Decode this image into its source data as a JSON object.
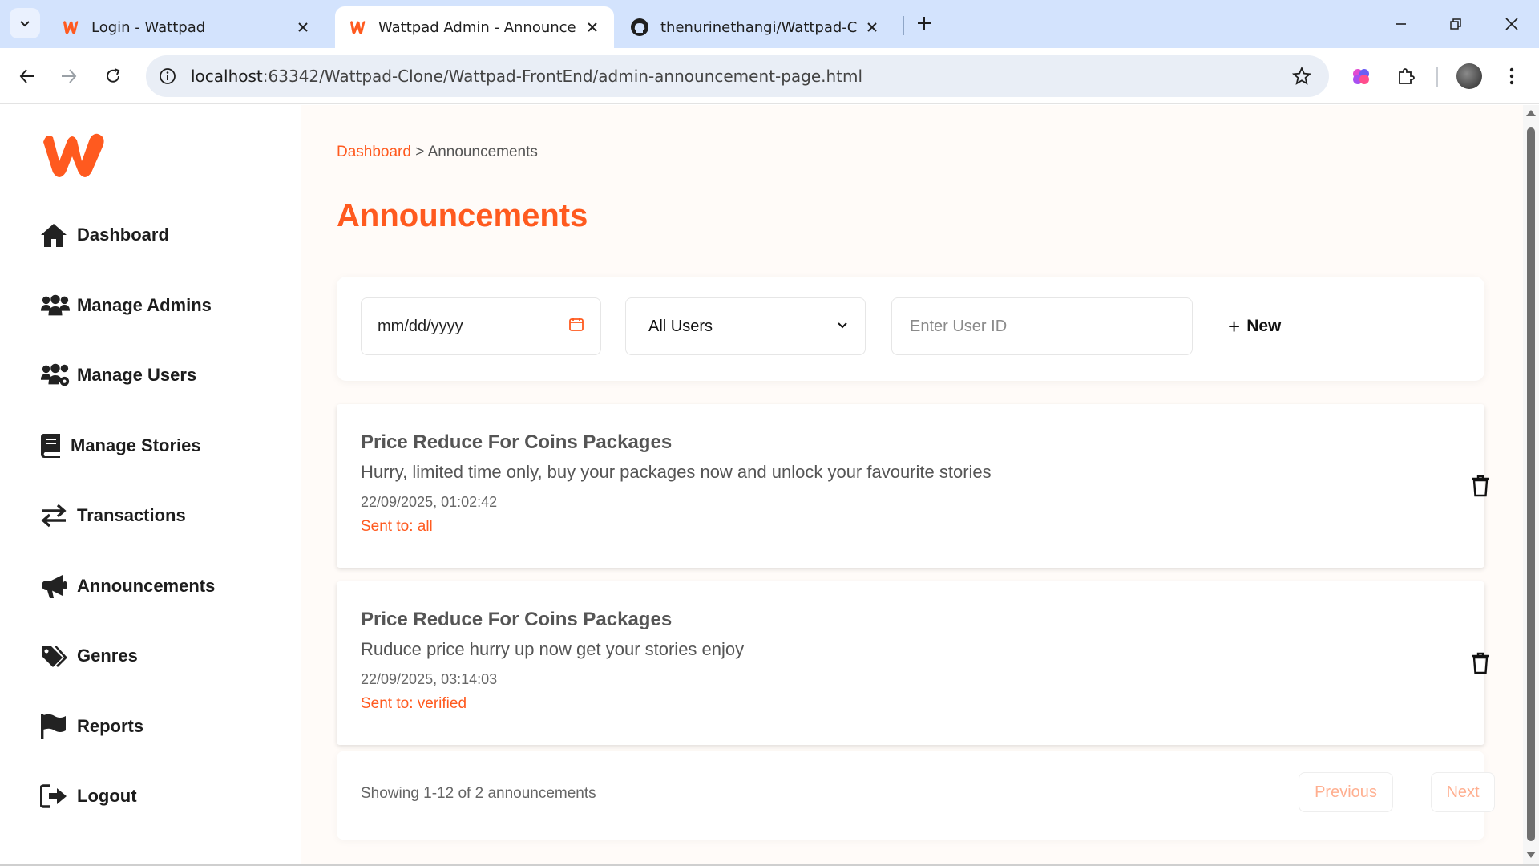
{
  "browser": {
    "tabs": [
      {
        "title": "Login - Wattpad",
        "active": false,
        "favicon": "wattpad-icon"
      },
      {
        "title": "Wattpad Admin - Announcements",
        "active": true,
        "favicon": "wattpad-icon"
      },
      {
        "title": "thenurinethangi/Wattpad-Clone",
        "active": false,
        "favicon": "github-icon"
      }
    ],
    "url_host": "localhost",
    "url_rest": ":63342/Wattpad-Clone/Wattpad-FrontEnd/admin-announcement-page.html"
  },
  "sidebar": {
    "items": [
      {
        "label": "Dashboard",
        "icon": "home-icon"
      },
      {
        "label": "Manage Admins",
        "icon": "users-icon"
      },
      {
        "label": "Manage Users",
        "icon": "users-gear-icon"
      },
      {
        "label": "Manage Stories",
        "icon": "book-icon"
      },
      {
        "label": "Transactions",
        "icon": "arrows-exchange-icon"
      },
      {
        "label": "Announcements",
        "icon": "megaphone-icon"
      },
      {
        "label": "Genres",
        "icon": "tags-icon"
      },
      {
        "label": "Reports",
        "icon": "flag-icon"
      },
      {
        "label": "Logout",
        "icon": "logout-icon"
      }
    ]
  },
  "breadcrumb": {
    "link": "Dashboard",
    "separator": " > ",
    "current": "Announcements"
  },
  "page_title": "Announcements",
  "filters": {
    "date_placeholder": "mm/dd/yyyy",
    "audience_selected": "All Users",
    "user_id_placeholder": "Enter User ID",
    "new_label": "New"
  },
  "announcements": [
    {
      "title": "Price Reduce For Coins Packages",
      "body": "Hurry, limited time only, buy your packages now and unlock your favourite stories",
      "timestamp": "22/09/2025, 01:02:42",
      "sent_to": "Sent to: all"
    },
    {
      "title": "Price Reduce For Coins Packages",
      "body": "Ruduce price hurry up now get your stories enjoy",
      "timestamp": "22/09/2025, 03:14:03",
      "sent_to": "Sent to: verified"
    }
  ],
  "pagination": {
    "info": "Showing 1-12 of 2 announcements",
    "previous_label": "Previous",
    "next_label": "Next"
  },
  "colors": {
    "accent": "#ff5a1f",
    "tabbar": "#d3e3fd"
  }
}
